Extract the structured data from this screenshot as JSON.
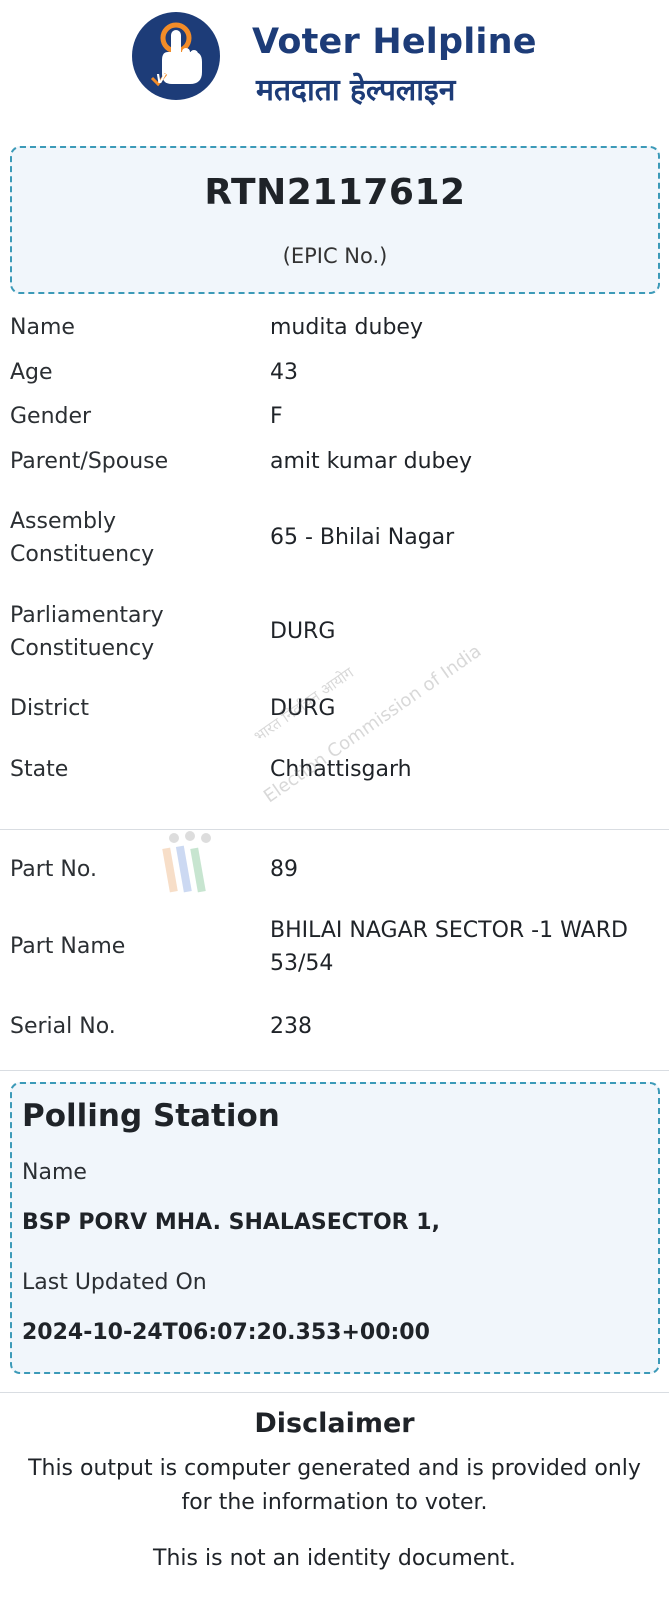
{
  "brand": {
    "title": "Voter Helpline",
    "title_hindi": "मतदाता हेल्पलाइन",
    "logo_text": "Voter",
    "colors": {
      "primary": "#1d3c78",
      "accent": "#f28c28",
      "border": "#3c9ab8",
      "box_bg": "#f1f6fb"
    }
  },
  "epic": {
    "number": "RTN2117612",
    "label": "(EPIC No.)"
  },
  "details": [
    {
      "label": "Name",
      "value": "mudita dubey"
    },
    {
      "label": "Age",
      "value": "43"
    },
    {
      "label": "Gender",
      "value": "F"
    },
    {
      "label": "Parent/Spouse",
      "value": "amit kumar dubey"
    },
    {
      "label": "Assembly Constituency",
      "value": "65 - Bhilai Nagar"
    },
    {
      "label": "Parliamentary Constituency",
      "value": "DURG"
    },
    {
      "label": "District",
      "value": "DURG"
    },
    {
      "label": "State",
      "value": "Chhattisgarh"
    }
  ],
  "part": [
    {
      "label": "Part No.",
      "value": "89"
    },
    {
      "label": "Part Name",
      "value": "BHILAI NAGAR SECTOR -1 WARD 53/54"
    },
    {
      "label": "Serial No.",
      "value": "238"
    }
  ],
  "watermark": {
    "line1": "भारत निर्वाचन आयोग",
    "line2": "Election Commission of India"
  },
  "polling_station": {
    "title": "Polling Station",
    "name_label": "Name",
    "name_value": "BSP PORV MHA. SHALASECTOR 1,",
    "updated_label": "Last Updated On",
    "updated_value": "2024-10-24T06:07:20.353+00:00"
  },
  "disclaimer": {
    "title": "Disclaimer",
    "text": "This output is computer generated and is provided only for the information to voter.",
    "text2": "This is not an identity document."
  }
}
